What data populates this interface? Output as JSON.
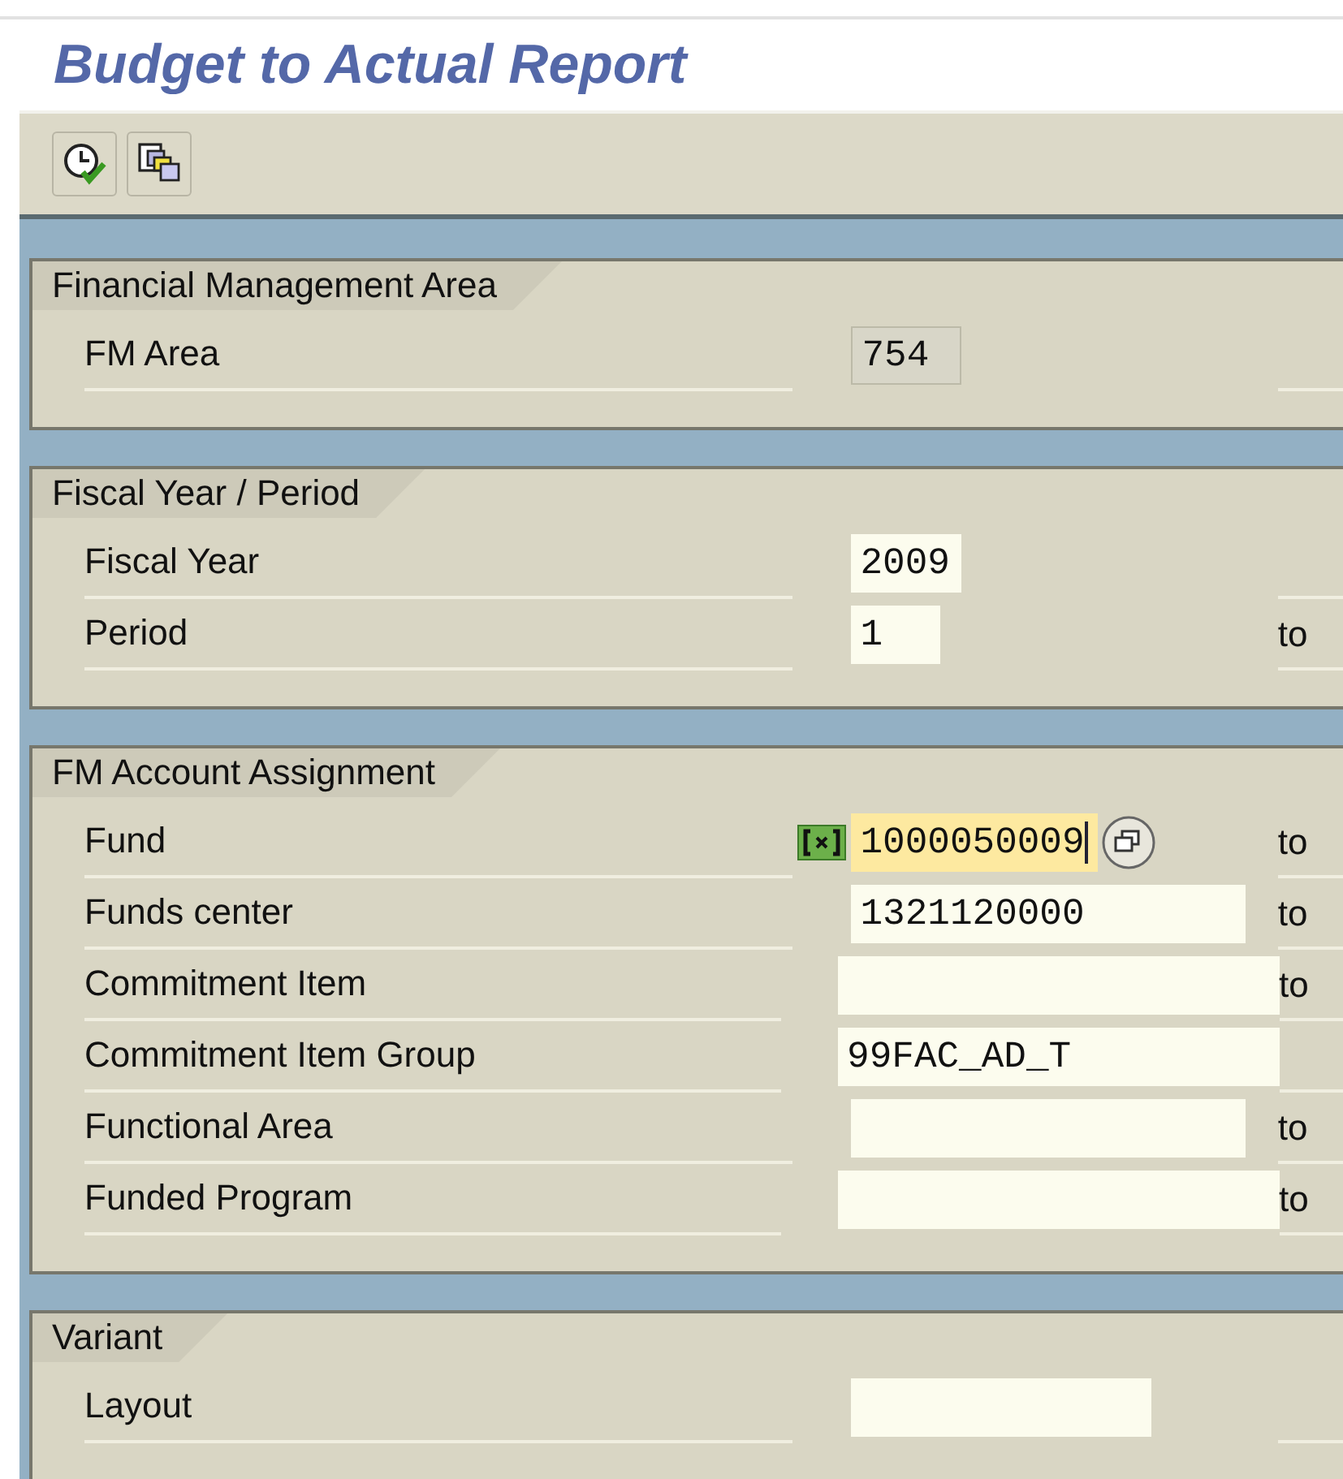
{
  "title": "Budget to Actual Report",
  "toolbar": [
    {
      "kind": "execute"
    },
    {
      "kind": "variants"
    }
  ],
  "groups": [
    {
      "title": "Financial Management Area",
      "rows": [
        {
          "label": "FM Area",
          "value": "754",
          "readonly": true,
          "focused": false
        }
      ]
    },
    {
      "title": "Fiscal Year / Period",
      "rows": [
        {
          "label": "Fiscal Year",
          "value": "2009",
          "readonly": false,
          "focused": false
        },
        {
          "label": "Period",
          "value": "1",
          "readonly": false,
          "focused": false,
          "range_label": "to"
        }
      ]
    },
    {
      "title": "FM Account Assignment",
      "rows": [
        {
          "label": "Fund",
          "value": "1000050009",
          "readonly": false,
          "focused": true,
          "multiple_selection": true,
          "value_help": true,
          "range_label": "to"
        },
        {
          "label": "Funds center",
          "value": "1321120000",
          "readonly": false,
          "focused": false,
          "range_label": "to"
        },
        {
          "label": "Commitment Item",
          "readonly": false,
          "focused": false,
          "range_label": "to"
        },
        {
          "label": "Commitment Item Group",
          "value": "99FAC_AD_T",
          "readonly": false,
          "focused": false
        },
        {
          "label": "Functional Area",
          "readonly": false,
          "focused": false,
          "range_label": "to"
        },
        {
          "label": "Funded Program",
          "readonly": false,
          "focused": false,
          "range_label": "to"
        }
      ]
    },
    {
      "title": "Variant",
      "rows": [
        {
          "label": "Layout",
          "readonly": false,
          "focused": false
        }
      ]
    }
  ]
}
